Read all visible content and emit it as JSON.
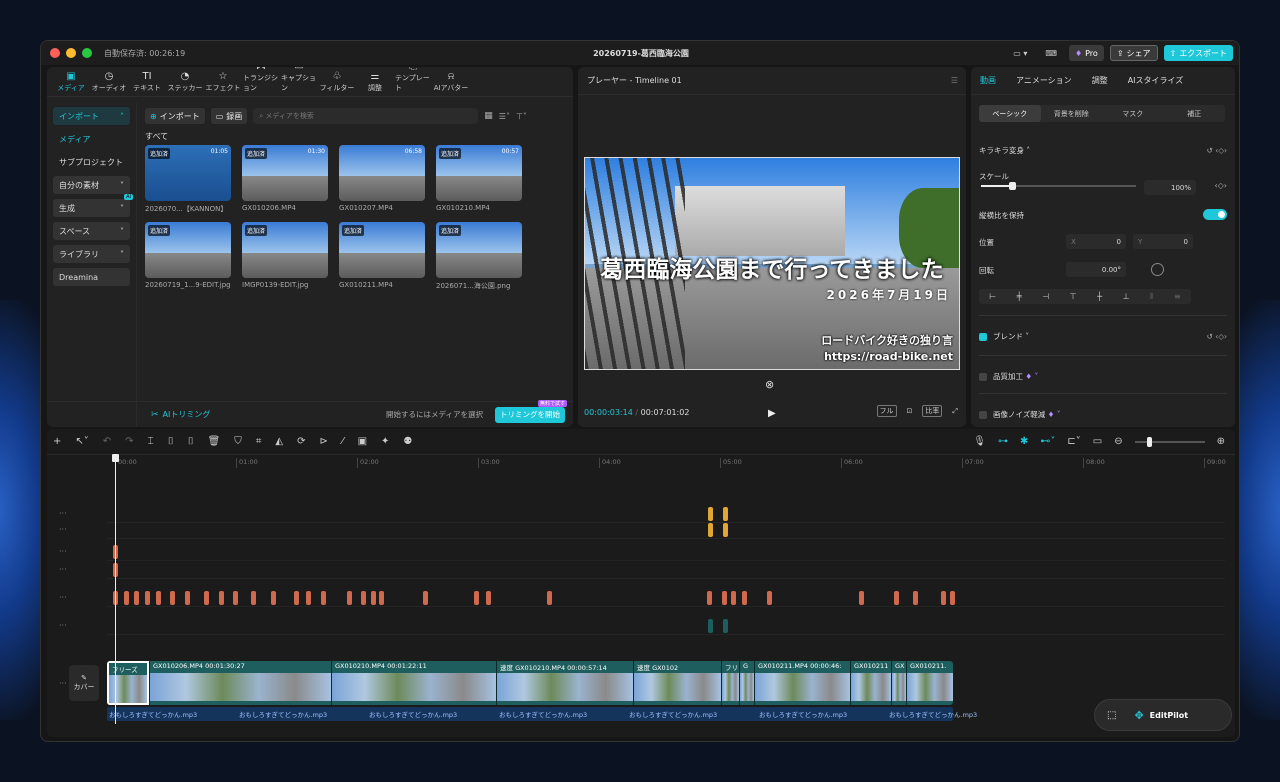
{
  "titlebar": {
    "autosave": "自動保存済: 00:26:19",
    "title": "20260719-葛西臨海公園",
    "pro": "Pro",
    "share": "シェア",
    "export": "エクスポート"
  },
  "toolbar": [
    {
      "label": "メディア",
      "icon": "media-icon"
    },
    {
      "label": "オーディオ",
      "icon": "audio-icon"
    },
    {
      "label": "テキスト",
      "icon": "text-icon"
    },
    {
      "label": "ステッカー",
      "icon": "sticker-icon"
    },
    {
      "label": "エフェクト",
      "icon": "effect-icon"
    },
    {
      "label": "トランジション",
      "icon": "transition-icon"
    },
    {
      "label": "キャプション",
      "icon": "caption-icon"
    },
    {
      "label": "フィルター",
      "icon": "filter-icon"
    },
    {
      "label": "調整",
      "icon": "adjust-icon"
    },
    {
      "label": "テンプレート",
      "icon": "template-icon"
    },
    {
      "label": "AIアバター",
      "icon": "avatar-icon"
    }
  ],
  "sidebar": {
    "import": "インポート",
    "media": "メディア",
    "subproject": "サブプロジェクト",
    "own": "自分の素材",
    "generate": "生成",
    "ai_badge": "AI",
    "space": "スペース",
    "library": "ライブラリ",
    "dreamina": "Dreamina"
  },
  "media": {
    "import_btn": "インポート",
    "record_btn": "録画",
    "search_placeholder": "メディアを検索",
    "all": "すべて",
    "items": [
      {
        "name": "2026070...【KANNON】",
        "badge": "追加済",
        "dur": "01:05"
      },
      {
        "name": "GX010206.MP4",
        "badge": "追加済",
        "dur": "01:30"
      },
      {
        "name": "GX010207.MP4",
        "badge": "",
        "dur": "06:58"
      },
      {
        "name": "GX010210.MP4",
        "badge": "追加済",
        "dur": "00:57"
      },
      {
        "name": "20260719_1...9-EDIT.jpg",
        "badge": "追加済",
        "dur": ""
      },
      {
        "name": "IMGP0139-EDIT.jpg",
        "badge": "追加済",
        "dur": ""
      },
      {
        "name": "GX010211.MP4",
        "badge": "追加済",
        "dur": ""
      },
      {
        "name": "2026071...海公園.png",
        "badge": "追加済",
        "dur": ""
      }
    ],
    "ai_trim": "AIトリミング",
    "hint": "開始するにはメディアを選択",
    "trim_btn": "トリミングを開始",
    "free_badge": "無料で試す"
  },
  "player": {
    "header": "プレーヤー - Timeline 01",
    "title_text": "葛西臨海公園まで行ってきました",
    "date_text": "2026年7月19日",
    "brand_text": "ロードバイク好きの独り言",
    "url_text": "https://road-bike.net",
    "current": "00:00:03:14",
    "total": "00:07:01:02",
    "full": "フル",
    "ratio": "比率"
  },
  "right": {
    "tabs": [
      "動画",
      "アニメーション",
      "調整",
      "AIスタイライズ"
    ],
    "subtabs": [
      "ベーシック",
      "背景を削除",
      "マスク",
      "補正"
    ],
    "section1": "キラキラ変身",
    "scale_label": "スケール",
    "scale_value": "100%",
    "scale_level": 0.2,
    "keep_ratio": "縦横比を保持",
    "position_label": "位置",
    "pos_x_label": "X",
    "pos_x": "0",
    "pos_y_label": "Y",
    "pos_y": "0",
    "rotate_label": "回転",
    "rotate_value": "0.00°",
    "blend": "ブレンド",
    "quality": "品質加工",
    "noise": "画像ノイズ軽減"
  },
  "timeline": {
    "ruler": [
      "00:00",
      "01:00",
      "02:00",
      "03:00",
      "04:00",
      "05:00",
      "06:00",
      "07:00",
      "08:00",
      "09:00"
    ],
    "cover": "カバー",
    "clips": [
      {
        "name": "フリーズ"
      },
      {
        "name": "GX010206.MP4  00:01:30:27"
      },
      {
        "name": "GX010210.MP4  00:01:22:11"
      },
      {
        "name": "速度  GX010210.MP4  00:00:57:14"
      },
      {
        "name": "速度  GX0102"
      },
      {
        "name": "フリ"
      },
      {
        "name": "G"
      },
      {
        "name": "GX010211.MP4  00:00:46:"
      },
      {
        "name": "GX010211"
      },
      {
        "name": "GX"
      },
      {
        "name": "GX010211."
      }
    ],
    "audio": [
      "おもしろすぎてどっかん.mp3",
      "おもしろすぎてどっかん.mp3",
      "おもしろすぎてどっかん.mp3",
      "おもしろすぎてどっかん.mp3",
      "おもしろすぎてどっかん.mp3",
      "おもしろすぎてどっかん.mp3",
      "おもしろすぎてどっかん.mp3"
    ],
    "editpilot": "EditPilot"
  },
  "colors": {
    "accent": "#1ec8d8",
    "orange": "#d06a4e",
    "yellow": "#e2a634",
    "teal": "#1f5e5e"
  }
}
